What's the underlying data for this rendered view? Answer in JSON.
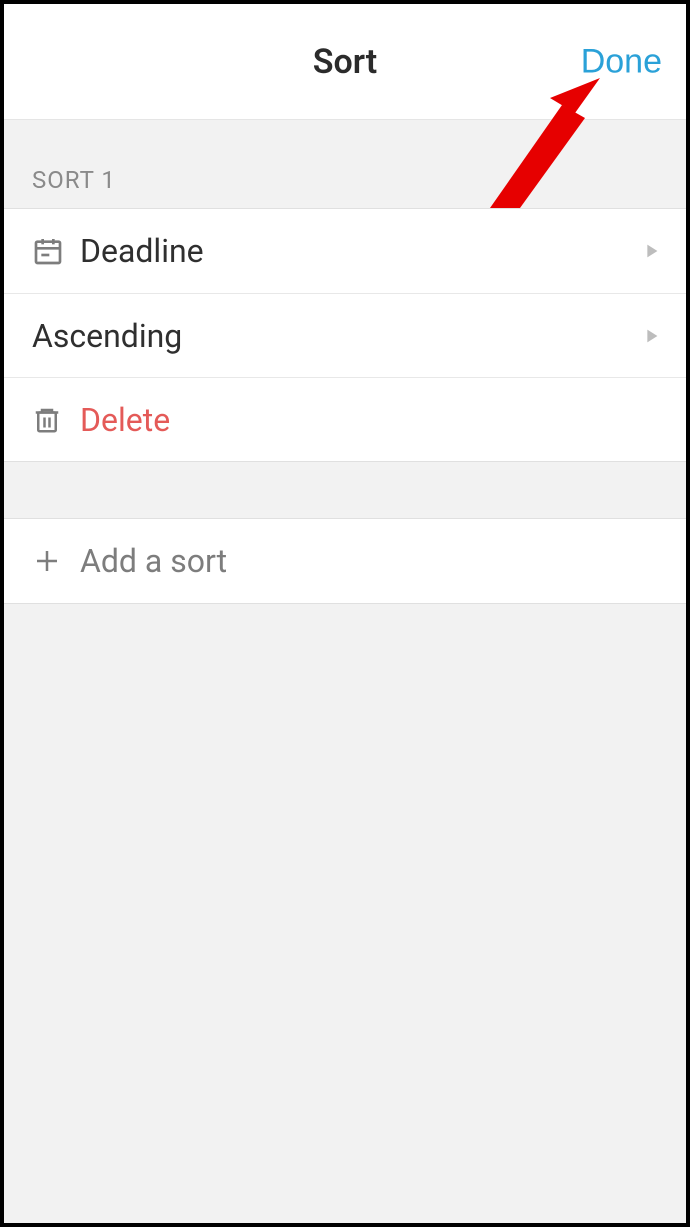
{
  "header": {
    "title": "Sort",
    "done_label": "Done"
  },
  "section": {
    "label": "SORT 1",
    "field_label": "Deadline",
    "order_label": "Ascending",
    "delete_label": "Delete"
  },
  "add_sort_label": "Add a sort"
}
